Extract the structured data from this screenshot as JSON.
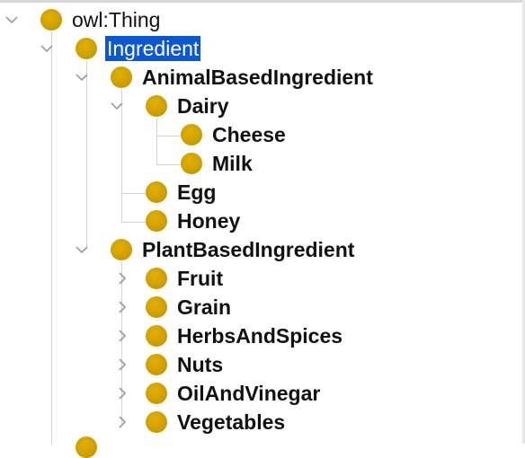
{
  "tree": {
    "root": {
      "label": "owl:Thing"
    },
    "ingredient": {
      "label": "Ingredient",
      "selected": true
    },
    "animal": {
      "label": "AnimalBasedIngredient"
    },
    "dairy": {
      "label": "Dairy"
    },
    "cheese": {
      "label": "Cheese"
    },
    "milk": {
      "label": "Milk"
    },
    "egg": {
      "label": "Egg"
    },
    "honey": {
      "label": "Honey"
    },
    "plant": {
      "label": "PlantBasedIngredient"
    },
    "fruit": {
      "label": "Fruit"
    },
    "grain": {
      "label": "Grain"
    },
    "herbs": {
      "label": "HerbsAndSpices"
    },
    "nuts": {
      "label": "Nuts"
    },
    "oil": {
      "label": "OilAndVinegar"
    },
    "vegetables": {
      "label": "Vegetables"
    }
  },
  "colors": {
    "bullet": "#cfa000",
    "selection": "#0b57d0",
    "guide": "#d3d3d3"
  }
}
